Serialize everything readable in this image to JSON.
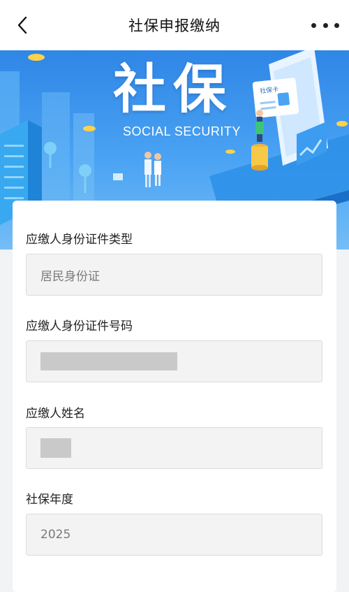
{
  "header": {
    "title": "社保申报缴纳"
  },
  "banner": {
    "title": "社保",
    "subtitle": "SOCIAL SECURITY",
    "card_text": "社保卡"
  },
  "form": {
    "fields": [
      {
        "label": "应缴人身份证件类型",
        "value": "居民身份证"
      },
      {
        "label": "应缴人身份证件号码",
        "value": ""
      },
      {
        "label": "应缴人姓名",
        "value": ""
      },
      {
        "label": "社保年度",
        "value": "2025"
      }
    ]
  },
  "icons": {
    "back": "chevron-left-icon",
    "more": "more-horizontal-icon"
  },
  "colors": {
    "banner_top": "#2f86e6",
    "banner_bottom": "#74bdf7",
    "field_bg": "#f3f3f3"
  }
}
